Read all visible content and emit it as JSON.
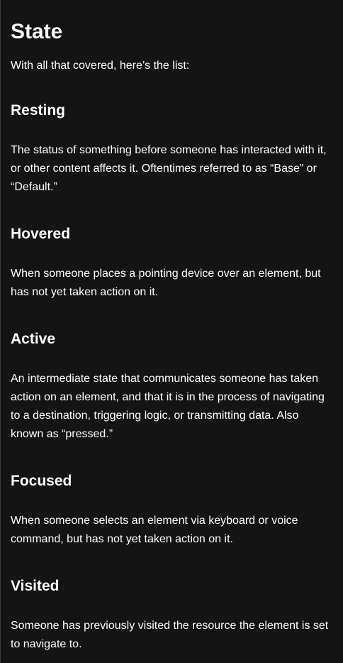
{
  "page": {
    "title": "State",
    "intro": "With all that covered, here’s the list:"
  },
  "sections": [
    {
      "heading": "Resting",
      "body": "The status of something before someone has interacted with it, or other content affects it. Oftentimes referred to as “Base” or “Default.”"
    },
    {
      "heading": "Hovered",
      "body": "When someone places a pointing device over an element, but has not yet taken action on it."
    },
    {
      "heading": "Active",
      "body": "An intermediate state that communicates someone has taken action on an element, and that it is in the process of navigating to a destination, triggering logic, or transmitting data. Also known as “pressed.”"
    },
    {
      "heading": "Focused",
      "body": "When someone selects an element via keyboard or voice command, but has not yet taken action on it."
    },
    {
      "heading": "Visited",
      "body": "Someone has previously visited the resource the element is set to navigate to."
    }
  ]
}
